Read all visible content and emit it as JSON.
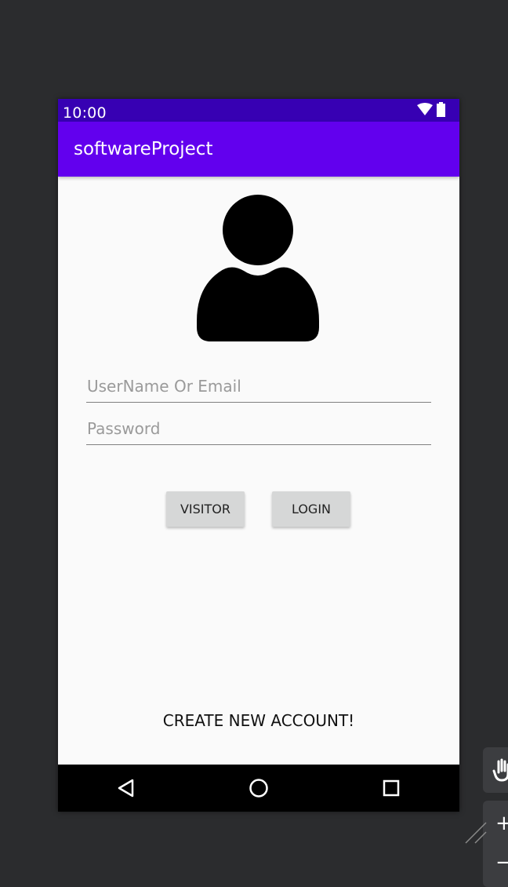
{
  "status": {
    "time": "10:00"
  },
  "appbar": {
    "title": "softwareProject"
  },
  "form": {
    "username_placeholder": "UserName Or Email",
    "password_placeholder": "Password"
  },
  "buttons": {
    "visitor": "VISITOR",
    "login": "LOGIN"
  },
  "create_account": "CREATE NEW ACCOUNT!",
  "icons": {
    "wifi": "wifi-icon",
    "battery": "battery-icon",
    "avatar": "user-avatar-icon",
    "back": "back-triangle-icon",
    "home": "home-circle-icon",
    "recents": "recents-square-icon",
    "hand": "hand-pan-icon",
    "zoom_in": "plus-icon",
    "zoom_out": "minus-icon"
  },
  "colors": {
    "status_bar": "#3700b3",
    "app_bar": "#6200ee",
    "background": "#fafafa",
    "button": "#d6d7d7",
    "nav_bar": "#000000",
    "canvas": "#2b2c2e"
  }
}
